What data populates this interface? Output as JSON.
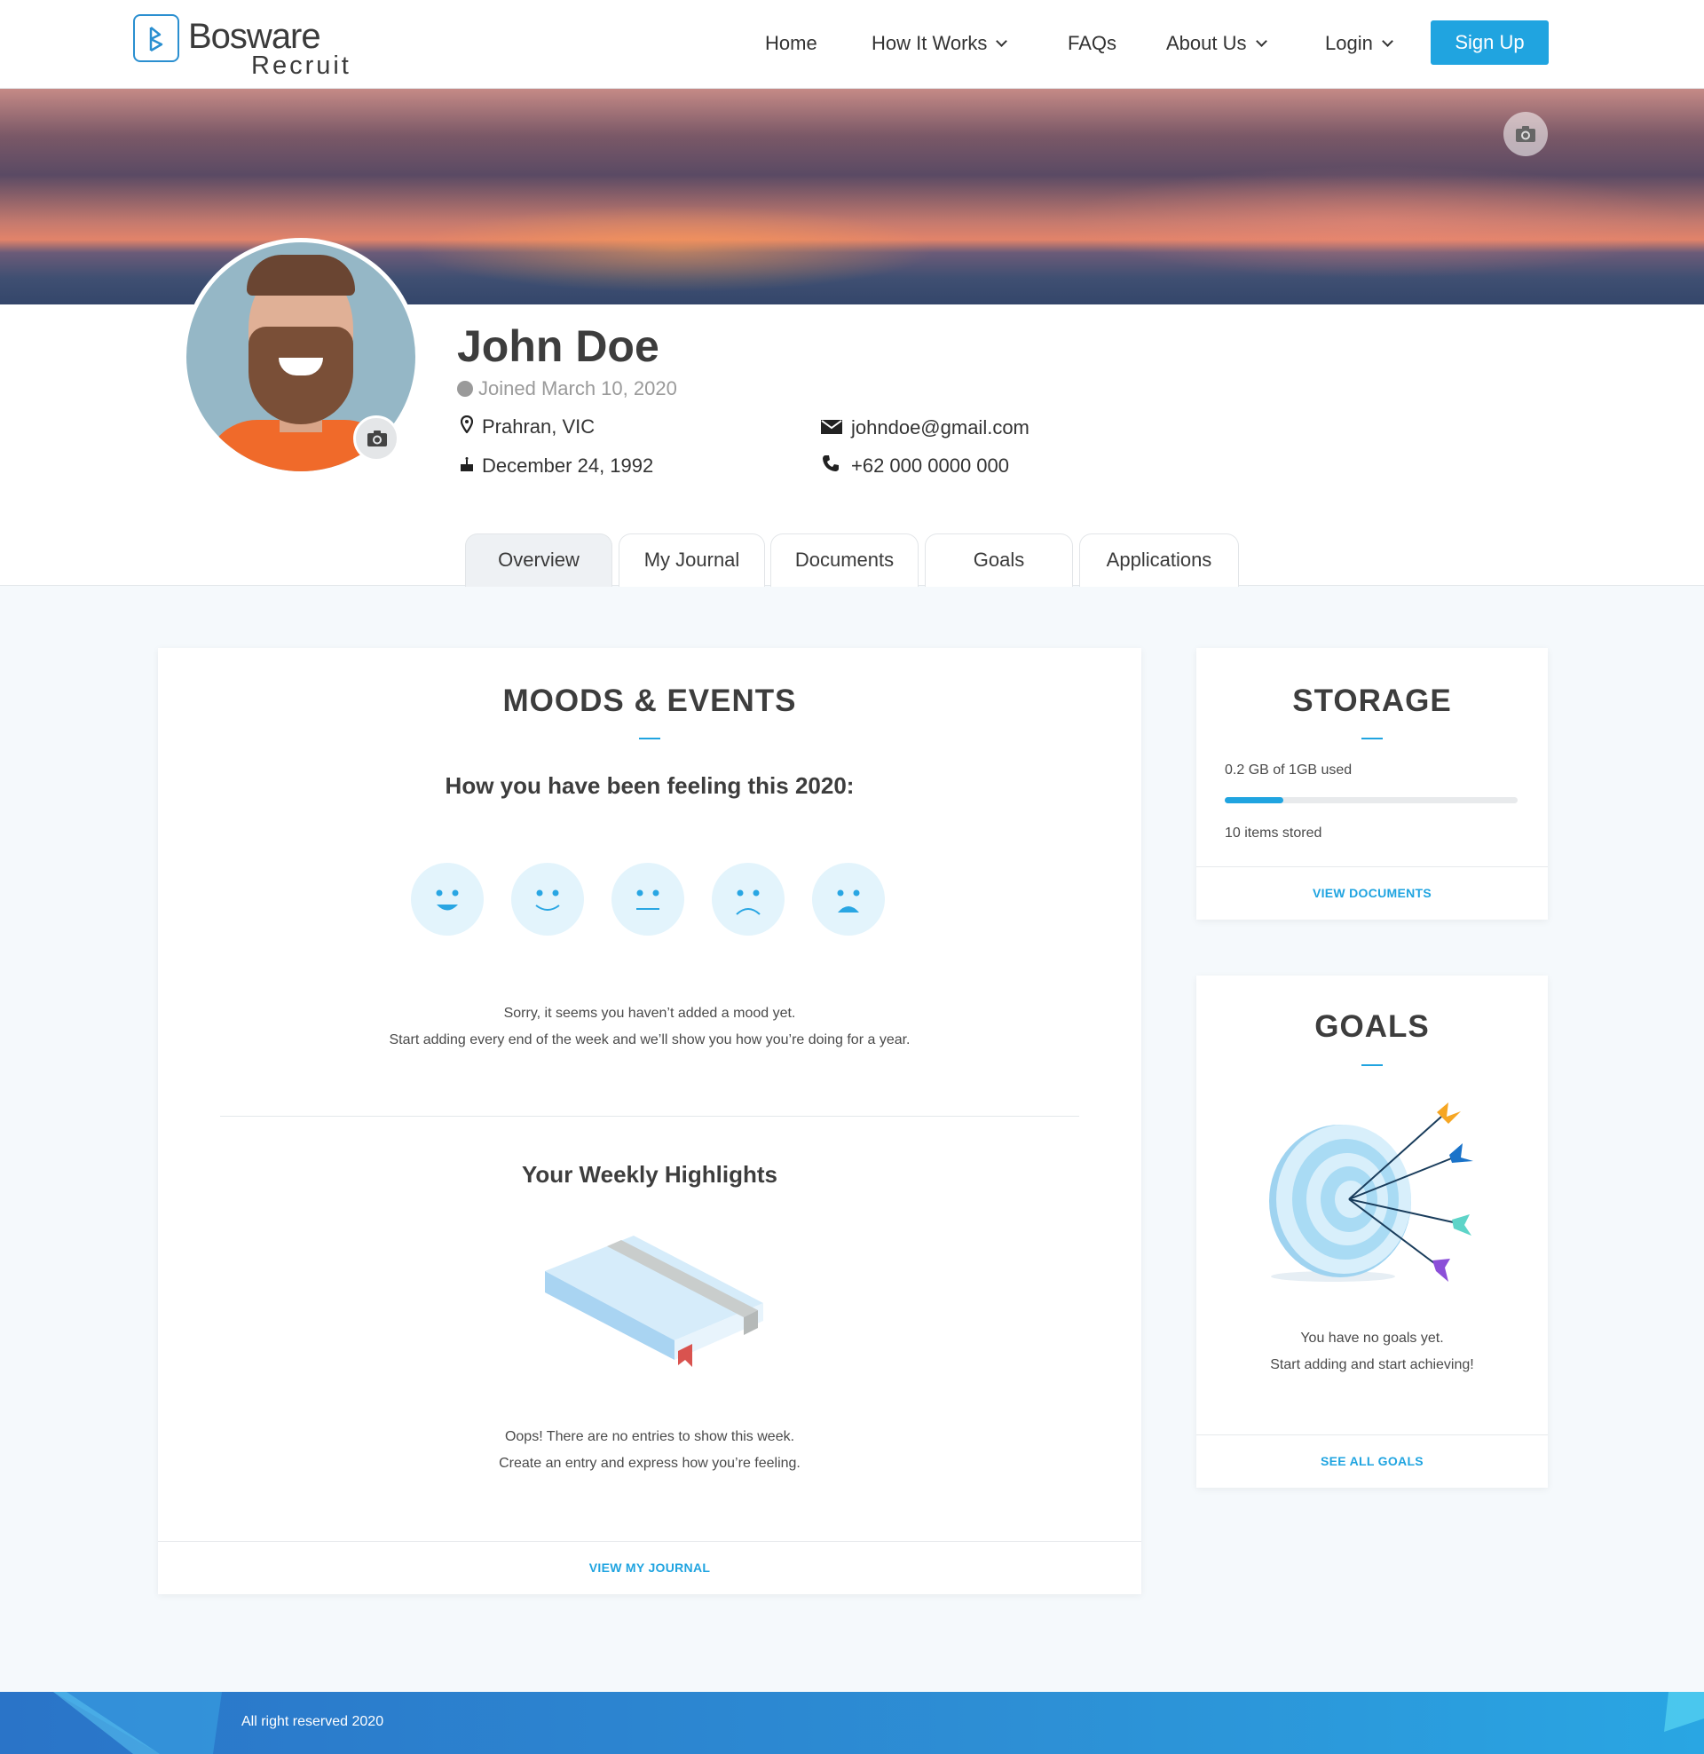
{
  "header": {
    "logo_name": "Bosware",
    "logo_sub": "Recruit",
    "nav": {
      "home": "Home",
      "how_it_works": "How It Works",
      "faqs": "FAQs",
      "about_us": "About Us",
      "login": "Login",
      "sign_up": "Sign Up"
    },
    "accent": "#20a4e0"
  },
  "profile": {
    "name": "John Doe",
    "joined": "Joined March 10, 2020",
    "location": "Prahran, VIC",
    "birthday": "December 24, 1992",
    "email": "johndoe@gmail.com",
    "phone": "+62 000 0000 000"
  },
  "tabs": [
    {
      "label": "Overview",
      "active": true
    },
    {
      "label": "My Journal",
      "active": false
    },
    {
      "label": "Documents",
      "active": false
    },
    {
      "label": "Goals",
      "active": false
    },
    {
      "label": "Applications",
      "active": false
    }
  ],
  "moods_card": {
    "title": "MOODS & EVENTS",
    "subtitle": "How you have been feeling this 2020:",
    "empty_line1": "Sorry, it seems you haven’t added a mood yet.",
    "empty_line2": "Start adding every end of the week and we’ll show you how you’re doing for a year.",
    "highlights_title": "Your Weekly Highlights",
    "highlights_line1": "Oops! There are no entries to show this week.",
    "highlights_line2": "Create an entry and express how you’re feeling.",
    "link": "VIEW MY JOURNAL",
    "mood_icons": [
      "very-happy-face-icon",
      "happy-face-icon",
      "neutral-face-icon",
      "sad-face-icon",
      "very-sad-face-icon"
    ]
  },
  "storage_card": {
    "title": "STORAGE",
    "used_text": "0.2 GB of 1GB used",
    "used_fraction": 0.2,
    "items_text": "10 items stored",
    "link": "VIEW DOCUMENTS"
  },
  "goals_card": {
    "title": "GOALS",
    "empty_line1": "You have no goals yet.",
    "empty_line2": "Start adding and start achieving!",
    "link": "SEE ALL GOALS"
  },
  "footer": {
    "text": "All right reserved 2020"
  }
}
